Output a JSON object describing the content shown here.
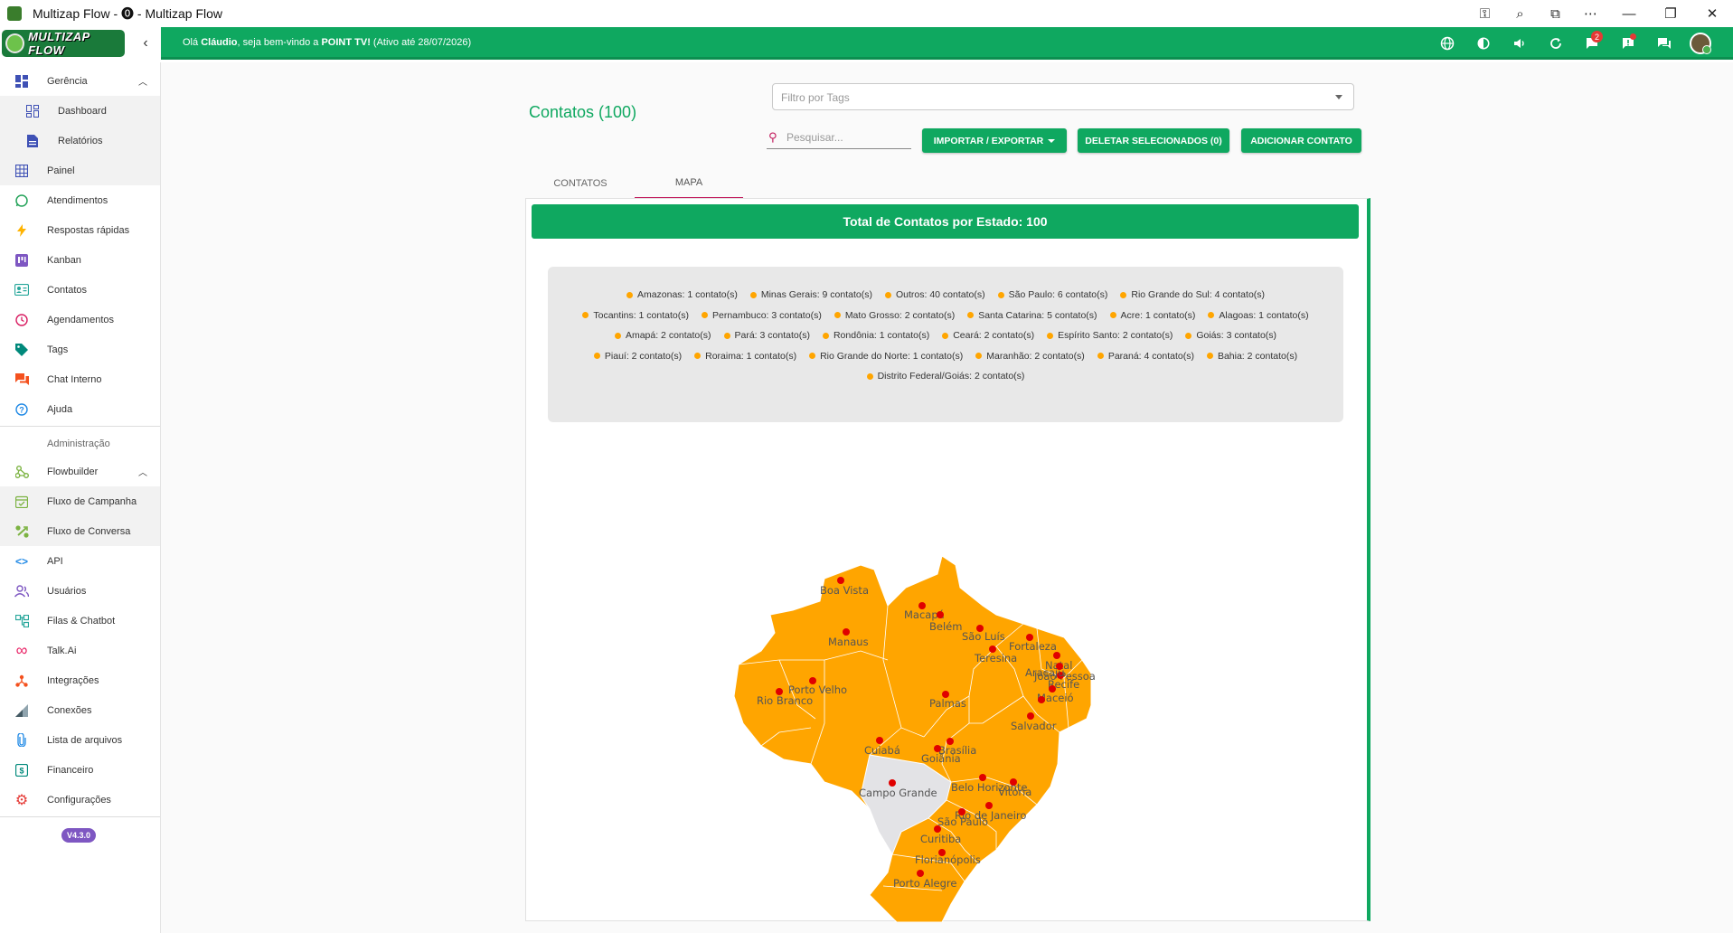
{
  "window": {
    "title": "Multizap Flow - ⓿ - Multizap Flow"
  },
  "logo": {
    "text": "MULTIZAP FLOW"
  },
  "topbar": {
    "welcome_prefix": "Olá ",
    "user_name": "Cláudio",
    "welcome_mid": ", seja bem-vindo a ",
    "company": "POINT TV!",
    "welcome_suffix": " (Ativo até 28/07/2026)",
    "chat_badge": "2"
  },
  "sidebar": {
    "gerencia": "Gerência",
    "dashboard": "Dashboard",
    "relatorios": "Relatórios",
    "painel": "Painel",
    "atendimentos": "Atendimentos",
    "respostas": "Respostas rápidas",
    "kanban": "Kanban",
    "contatos": "Contatos",
    "agendamentos": "Agendamentos",
    "tags": "Tags",
    "chat_interno": "Chat Interno",
    "ajuda": "Ajuda",
    "administracao": "Administração",
    "flowbuilder": "Flowbuilder",
    "fluxo_campanha": "Fluxo de Campanha",
    "fluxo_conversa": "Fluxo de Conversa",
    "api": "API",
    "usuarios": "Usuários",
    "filas": "Filas & Chatbot",
    "talkai": "Talk.Ai",
    "integracoes": "Integrações",
    "conexoes": "Conexões",
    "lista_arquivos": "Lista de arquivos",
    "financeiro": "Financeiro",
    "configuracoes": "Configurações",
    "version": "V4.3.0"
  },
  "main": {
    "title": "Contatos (100)",
    "tag_filter_placeholder": "Filtro por Tags",
    "search_placeholder": "Pesquisar...",
    "import_export": "IMPORTAR / EXPORTAR",
    "delete_selected": "DELETAR SELECIONADOS (0)",
    "add_contact": "ADICIONAR CONTATO",
    "tab_contacts": "CONTATOS",
    "tab_map": "MAPA",
    "panel_title": "Total de Contatos por Estado: 100"
  },
  "legend": [
    "Amazonas: 1 contato(s)",
    "Minas Gerais: 9 contato(s)",
    "Outros: 40 contato(s)",
    "São Paulo: 6 contato(s)",
    "Rio Grande do Sul: 4 contato(s)",
    "Tocantins: 1 contato(s)",
    "Pernambuco: 3 contato(s)",
    "Mato Grosso: 2 contato(s)",
    "Santa Catarina: 5 contato(s)",
    "Acre: 1 contato(s)",
    "Alagoas: 1 contato(s)",
    "Amapá: 2 contato(s)",
    "Pará: 3 contato(s)",
    "Rondônia: 1 contato(s)",
    "Ceará: 2 contato(s)",
    "Espírito Santo: 2 contato(s)",
    "Goiás: 3 contato(s)",
    "Piauí: 2 contato(s)",
    "Roraima: 1 contato(s)",
    "Rio Grande do Norte: 1 contato(s)",
    "Maranhão: 2 contato(s)",
    "Paraná: 4 contato(s)",
    "Bahia: 2 contato(s)",
    "Distrito Federal/Goiás: 2 contato(s)"
  ],
  "cities": {
    "boa_vista": "Boa Vista",
    "macapa": "Macapá",
    "belem": "Belém",
    "sao_luis": "São Luís",
    "fortaleza": "Fortaleza",
    "manaus": "Manaus",
    "teresina": "Teresina",
    "natal": "Natal",
    "joao_pessoa": "João Pessoa",
    "recife": "Recife",
    "aracaju": "Aracaju",
    "maceio": "Maceió",
    "porto_velho": "Porto Velho",
    "rio_branco": "Rio Branco",
    "palmas": "Palmas",
    "salvador": "Salvador",
    "cuiaba": "Cuiabá",
    "brasilia": "Brasília",
    "goiania": "Goiânia",
    "campo_grande": "Campo Grande",
    "belo_horizonte": "Belo Horizonte",
    "vitoria": "Vitória",
    "rio": "Rio de Janeiro",
    "sao_paulo": "São Paulo",
    "curitiba": "Curitiba",
    "florianopolis": "Florianópolis",
    "porto_alegre": "Porto Alegre"
  },
  "colors": {
    "accent": "#0fa860",
    "map_fill": "#ffa500",
    "marker": "#e00000",
    "tab_indicator": "#c2185b"
  }
}
